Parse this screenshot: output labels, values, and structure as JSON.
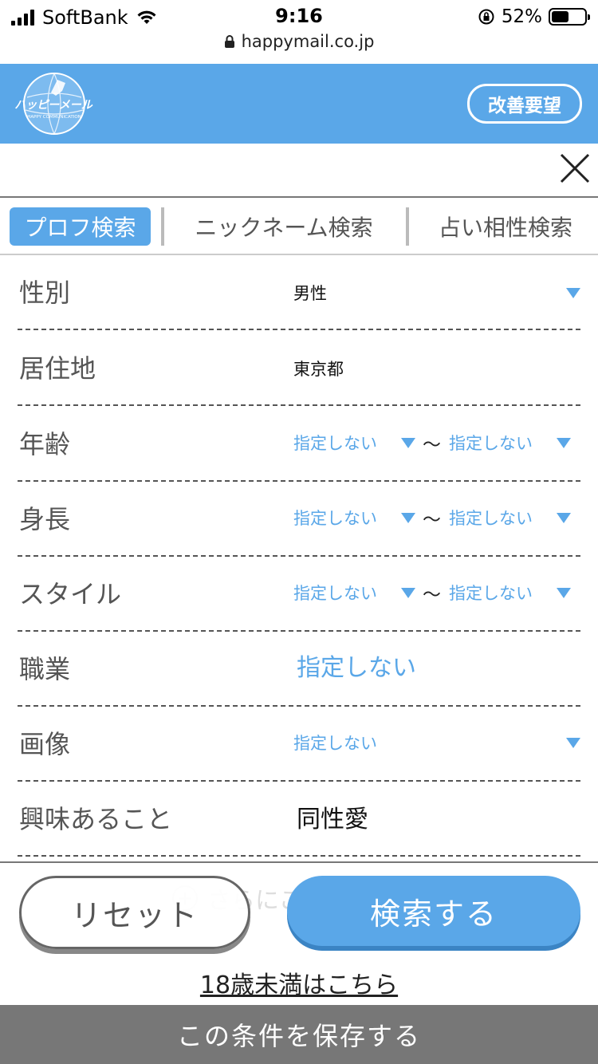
{
  "status_bar": {
    "carrier": "SoftBank",
    "time": "9:16",
    "battery": "52%",
    "battery_level": 0.52,
    "url": "happymail.co.jp"
  },
  "header": {
    "logo_text": "ハッピーメール",
    "logo_subtext": "HAPPY COMMUNICATION",
    "improve_button": "改善要望",
    "brand_color": "#5aa7e8"
  },
  "tabs": [
    {
      "label": "プロフ検索",
      "active": true
    },
    {
      "label": "ニックネーム検索",
      "active": false
    },
    {
      "label": "占い相性検索",
      "active": false
    }
  ],
  "form": {
    "gender": {
      "label": "性別",
      "value": "男性"
    },
    "residence": {
      "label": "居住地",
      "value": "東京都"
    },
    "age": {
      "label": "年齢",
      "from": "指定しない",
      "separator": "〜",
      "to": "指定しない"
    },
    "height": {
      "label": "身長",
      "from": "指定しない",
      "separator": "〜",
      "to": "指定しない"
    },
    "style": {
      "label": "スタイル",
      "from": "指定しない",
      "separator": "〜",
      "to": "指定しない"
    },
    "occupation": {
      "label": "職業",
      "value": "指定しない"
    },
    "image": {
      "label": "画像",
      "value": "指定しない"
    },
    "interests": {
      "label": "興味あること",
      "value": "同性愛"
    }
  },
  "more_conditions": "さらにこだわる",
  "buttons": {
    "reset": "リセット",
    "search": "検索する",
    "under18": "18歳未満はこちら",
    "save": "この条件を保存する"
  }
}
